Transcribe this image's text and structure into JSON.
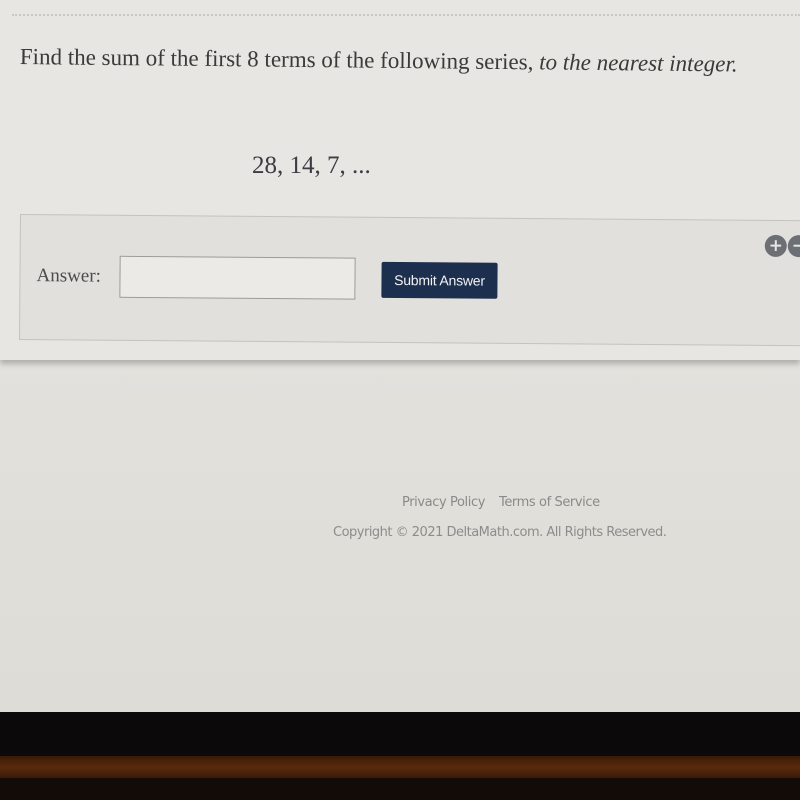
{
  "question": {
    "text_plain": "Find the sum of the first 8 terms of the following series, ",
    "text_italic": "to the nearest integer.",
    "series": "28, 14, 7, ..."
  },
  "answer": {
    "label": "Answer:",
    "input_value": "",
    "input_placeholder": "",
    "submit_label": "Submit Answer",
    "zoom_in_icon": "plus-circle-icon",
    "zoom_out_icon": "minus-circle-icon",
    "zoom_in_glyph": "+",
    "zoom_out_glyph": "−"
  },
  "footer": {
    "links": [
      "Privacy Policy",
      "Terms of Service"
    ],
    "copyright": "Copyright © 2021 DeltaMath.com. All Rights Reserved."
  },
  "colors": {
    "submit_button": "#1c2f4e",
    "page_background": "#e3e2de",
    "text": "#3a3a3a"
  }
}
